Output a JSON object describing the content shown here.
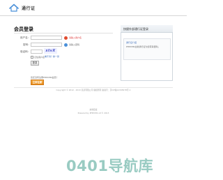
{
  "header": {
    "site_name": "通行证",
    "home_icon": "home-icon"
  },
  "login": {
    "title": "会员登录",
    "username_label": "用户名：",
    "username_value": "",
    "username_hint": "请输入用户名",
    "password_label": "密码：",
    "password_value": "",
    "password_hint": "请输入密码",
    "captcha_label": "验证码：",
    "captcha_value": "",
    "captcha_image_text": "xtvX",
    "captcha_refresh": "看不清？换一张",
    "remember_label": "记住用户名",
    "remember_hint": "自动登录",
    "submit_label": "登录",
    "register_prompt": "您还没有注册PHPCMS会员？",
    "register_label": "立即注册"
  },
  "side_panel": {
    "title": "快捷外部通行证登录",
    "line1": "通行证介绍",
    "line2": "PHPCMS全新通行证为您带来便利。"
  },
  "footer": {
    "copyright": "Copyright © 2012 - 2013 某某有限公司 版权所有 备案号：京ICP备12345678号-1",
    "line2": "友情链接",
    "powered": "Powered by PHPCMS v9 © 2013"
  },
  "watermark": "0401导航库",
  "colors": {
    "accent": "#e88a17",
    "error": "#e04a2e",
    "info": "#4a90d9",
    "link": "#3367b7"
  }
}
